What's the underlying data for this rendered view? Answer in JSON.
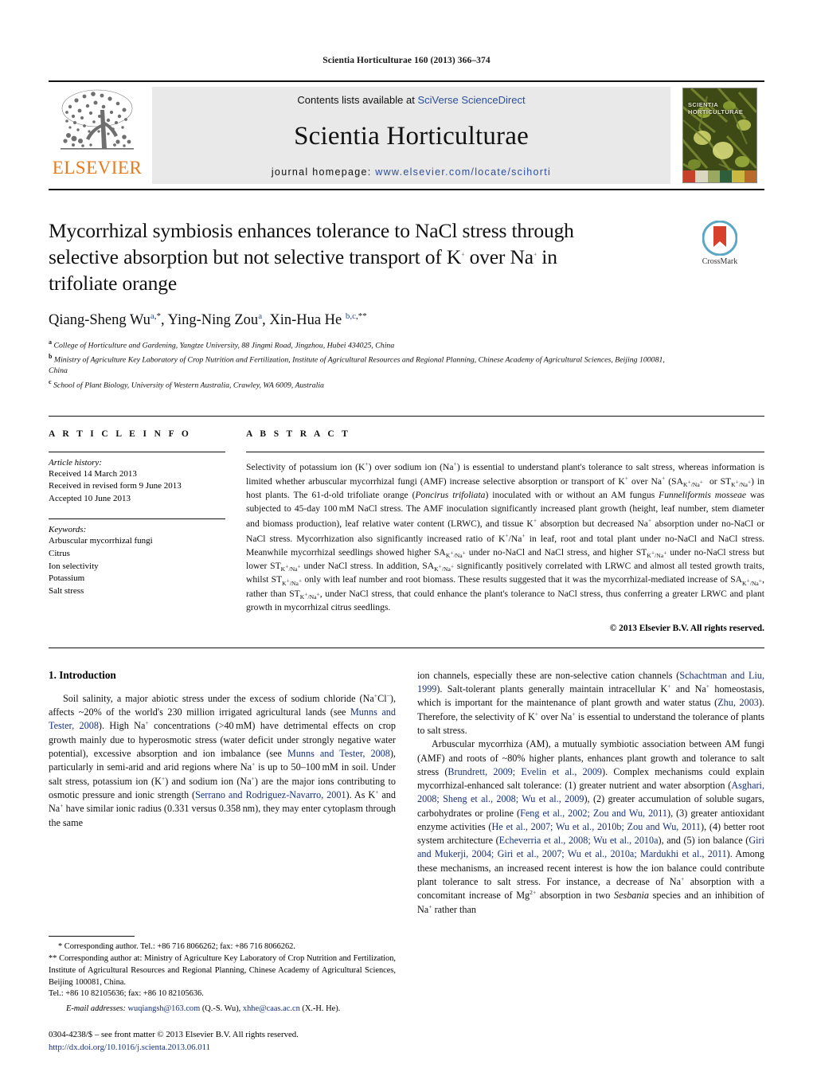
{
  "running_head": "Scientia Horticulturae 160 (2013) 366–374",
  "masthead": {
    "contents_prefix": "Contents lists available at ",
    "contents_brand": "SciVerse ScienceDirect",
    "journal_title": "Scientia Horticulturae",
    "homepage_prefix": "journal homepage: ",
    "homepage_url": "www.elsevier.com/locate/scihorti",
    "publisher": "ELSEVIER",
    "cover_title_line1": "SCIENTIA",
    "cover_title_line2": "HORTICULTURAE"
  },
  "crossmark": {
    "label": "CrossMark"
  },
  "article": {
    "title": "Mycorrhizal symbiosis enhances tolerance to NaCl stress through selective absorption but not selective transport of K+ over Na+ in trifoliate orange",
    "title_parts": {
      "l1a": "Mycorrhizal symbiosis enhances tolerance to NaCl stress through",
      "l2a": "selective absorption but not selective transport of K",
      "l2b": "+",
      "l2c": " over Na",
      "l2d": "+",
      "l2e": " in",
      "l3a": "trifoliate orange"
    },
    "authors": [
      {
        "name": "Qiang-Sheng Wu",
        "affil": "a",
        "mark": ",*"
      },
      {
        "name": "Ying-Ning Zou",
        "affil": "a",
        "mark": ""
      },
      {
        "name": "Xin-Hua He",
        "affil": "b,c",
        "mark": ",**"
      }
    ],
    "affiliations": [
      {
        "marker": "a",
        "text": "College of Horticulture and Gardening, Yangtze University, 88 Jingmi Road, Jingzhou, Hubei 434025, China"
      },
      {
        "marker": "b",
        "text": "Ministry of Agriculture Key Laboratory of Crop Nutrition and Fertilization, Institute of Agricultural Resources and Regional Planning, Chinese Academy of Agricultural Sciences, Beijing 100081, China"
      },
      {
        "marker": "c",
        "text": "School of Plant Biology, University of Western Australia, Crawley, WA 6009, Australia"
      }
    ]
  },
  "article_info": {
    "heading": "A R T I C L E   I N F O",
    "history_label": "Article history:",
    "history": [
      "Received 14 March 2013",
      "Received in revised form 9 June 2013",
      "Accepted 10 June 2013"
    ],
    "keywords_label": "Keywords:",
    "keywords": [
      "Arbuscular mycorrhizal fungi",
      "Citrus",
      "Ion selectivity",
      "Potassium",
      "Salt stress"
    ]
  },
  "abstract": {
    "heading": "A B S T R A C T",
    "copyright": "© 2013 Elsevier B.V. All rights reserved.",
    "text": "Selectivity of potassium ion (K+) over sodium ion (Na+) is essential to understand plant's tolerance to salt stress, whereas information is limited whether arbuscular mycorrhizal fungi (AMF) increase selective absorption or transport of K+ over Na+ (SA K+/Na+ or ST K+/Na+) in host plants. The 61-d-old trifoliate orange (Poncirus trifoliata) inoculated with or without an AM fungus Funneliformis mosseae was subjected to 45-day 100 mM NaCl stress. The AMF inoculation significantly increased plant growth (height, leaf number, stem diameter and biomass production), leaf relative water content (LRWC), and tissue K+ absorption but decreased Na+ absorption under no-NaCl or NaCl stress. Mycorrhization also significantly increased ratio of K+/Na+ in leaf, root and total plant under no-NaCl and NaCl stress. Meanwhile mycorrhizal seedlings showed higher SA K+/Na+ under no-NaCl and NaCl stress, and higher ST K+/Na+ under no-NaCl stress but lower ST K+/Na+ under NaCl stress. In addition, SA K+/Na+ significantly positively correlated with LRWC and almost all tested growth traits, whilst ST K+/Na+ only with leaf number and root biomass. These results suggested that it was the mycorrhizal-mediated increase of SA K+/Na+, rather than ST K+/Na+, under NaCl stress, that could enhance the plant's tolerance to NaCl stress, thus conferring a greater LRWC and plant growth in mycorrhizal citrus seedlings."
  },
  "introduction": {
    "heading": "1.  Introduction",
    "para1": "Soil salinity, a major abiotic stress under the excess of sodium chloride (Na+Cl−), affects ~20% of the world's 230 million irrigated agricultural lands (see Munns and Tester, 2008). High Na+ concentrations (>40 mM) have detrimental effects on crop growth mainly due to hyperosmotic stress (water deficit under strongly negative water potential), excessive absorption and ion imbalance (see Munns and Tester, 2008), particularly in semi-arid and arid regions where Na+ is up to 50–100 mM in soil. Under salt stress, potassium ion (K+) and sodium ion (Na+) are the major ions contributing to osmotic pressure and ionic strength (Serrano and Rodriguez-Navarro, 2001). As K+ and Na+ have similar ionic radius (0.331 versus 0.358 nm), they may enter cytoplasm through the same ion channels, especially these are non-selective cation channels (Schachtman and Liu, 1999). Salt-tolerant plants generally maintain intracellular K+ and Na+ homeostasis, which is important for the maintenance of plant growth and water status (Zhu, 2003). Therefore, the selectivity of K+ over Na+ is essential to understand the tolerance of plants to salt stress.",
    "para2": "Arbuscular mycorrhiza (AM), a mutually symbiotic association between AM fungi (AMF) and roots of ~80% higher plants, enhances plant growth and tolerance to salt stress (Brundrett, 2009; Evelin et al., 2009). Complex mechanisms could explain mycorrhizal-enhanced salt tolerance: (1) greater nutrient and water absorption (Asghari, 2008; Sheng et al., 2008; Wu et al., 2009), (2) greater accumulation of soluble sugars, carbohydrates or proline (Feng et al., 2002; Zou and Wu, 2011), (3) greater antioxidant enzyme activities (He et al., 2007; Wu et al., 2010b; Zou and Wu, 2011), (4) better root system architecture (Echeverria et al., 2008; Wu et al., 2010a), and (5) ion balance (Giri and Mukerji, 2004; Giri et al., 2007; Wu et al., 2010a; Mardukhi et al., 2011). Among these mechanisms, an increased recent interest is how the ion balance could contribute plant tolerance to salt stress. For instance, a decrease of Na+ absorption with a concomitant increase of Mg2+ absorption in two Sesbania species and an inhibition of Na+ rather than"
  },
  "footnotes": {
    "star": "*  Corresponding author. Tel.: +86 716 8066262; fax: +86 716 8066262.",
    "double_star": "**  Corresponding author at: Ministry of Agriculture Key Laboratory of Crop Nutrition and Fertilization, Institute of Agricultural Resources and Regional Planning, Chinese Academy of Agricultural Sciences, Beijing 100081, China.",
    "tel": "Tel.: +86 10 82105636; fax: +86 10 82105636.",
    "email_label": "E-mail addresses:",
    "email1": "wuqiangsh@163.com",
    "email1_owner": "(Q.-S. Wu),",
    "email2": "xhhe@caas.ac.cn",
    "email2_owner": "(X.-H. He)."
  },
  "imprint": {
    "issn_line": "0304-4238/$ – see front matter © 2013 Elsevier B.V. All rights reserved.",
    "doi": "http://dx.doi.org/10.1016/j.scienta.2013.06.011"
  },
  "colors": {
    "link": "#16317d",
    "brand_blue": "#2a4fa2",
    "elsevier_orange": "#e77a1e"
  }
}
